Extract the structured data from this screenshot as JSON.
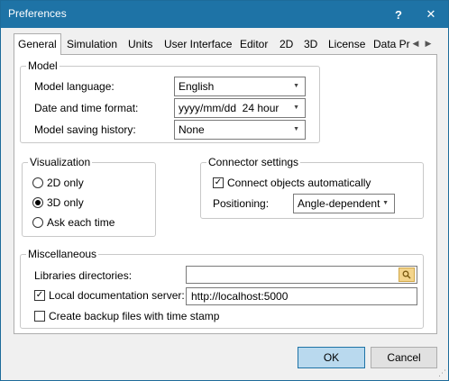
{
  "window": {
    "title": "Preferences",
    "help_glyph": "?",
    "close_glyph": "✕"
  },
  "tabs": {
    "items": [
      "General",
      "Simulation",
      "Units",
      "User Interface",
      "Editor",
      "2D",
      "3D",
      "License",
      "Data Pr"
    ],
    "active": "General",
    "prev_glyph": "◀",
    "next_glyph": "▶"
  },
  "model": {
    "heading": "Model",
    "language_label": "Model language:",
    "language_value": "English",
    "datetime_label": "Date and time format:",
    "datetime_value": "yyyy/mm/dd  24 hour",
    "history_label": "Model saving history:",
    "history_value": "None",
    "arrow_glyph": "▼"
  },
  "visualization": {
    "heading": "Visualization",
    "options": [
      "2D only",
      "3D only",
      "Ask each time"
    ],
    "selected": "3D only"
  },
  "connector": {
    "heading": "Connector settings",
    "auto_connect_label": "Connect objects automatically",
    "auto_connect_checked": true,
    "positioning_label": "Positioning:",
    "positioning_value": "Angle-dependent"
  },
  "misc": {
    "heading": "Miscellaneous",
    "libraries_label": "Libraries directories:",
    "libraries_value": "",
    "local_docs_label": "Local documentation server:",
    "local_docs_checked": true,
    "local_docs_value": "http://localhost:5000",
    "backup_label": "Create backup files with time stamp",
    "backup_checked": false,
    "check_glyph": "✓"
  },
  "footer": {
    "ok_label": "OK",
    "cancel_label": "Cancel"
  },
  "colors": {
    "titlebar": "#1e73a6",
    "ok_button": "#b9d9ee",
    "browse_button": "#f3d48c"
  }
}
